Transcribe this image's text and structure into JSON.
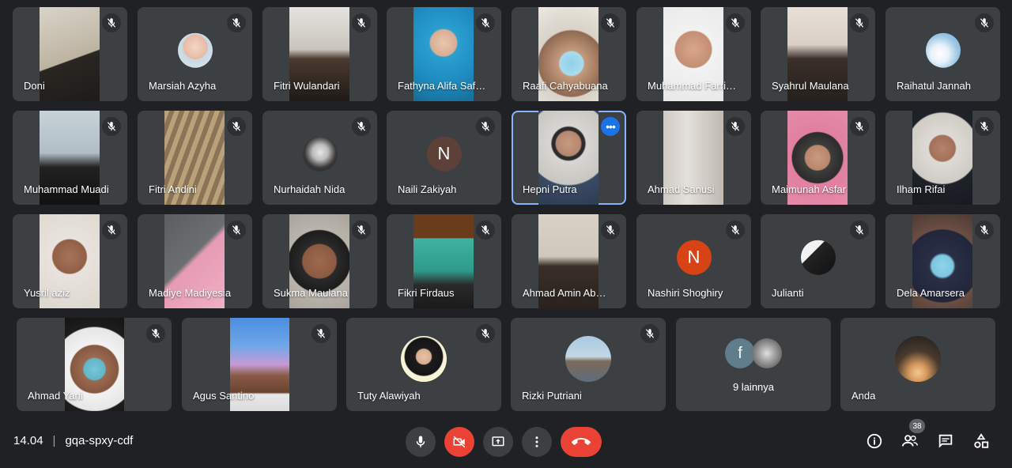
{
  "participants_row1": [
    {
      "name": "Doni"
    },
    {
      "name": "Marsiah Azyha"
    },
    {
      "name": "Fitri Wulandari"
    },
    {
      "name": "Fathyna Alifa Saf…"
    },
    {
      "name": "Raafi Cahyabuana"
    },
    {
      "name": "Muhammad Farri…"
    },
    {
      "name": "Syahrul Maulana"
    },
    {
      "name": "Raihatul Jannah"
    }
  ],
  "participants_row2": [
    {
      "name": "Muhammad Muadi"
    },
    {
      "name": "Fitri Andini"
    },
    {
      "name": "Nurhaidah Nida"
    },
    {
      "name": "Naili Zakiyah",
      "initial": "N"
    },
    {
      "name": "Hepni Putra"
    },
    {
      "name": "Ahmad Sanusi"
    },
    {
      "name": "Maimunah Asfar"
    },
    {
      "name": "Ilham Rifai"
    }
  ],
  "participants_row3": [
    {
      "name": "Yusril aziz"
    },
    {
      "name": "Madiye Madiyesia"
    },
    {
      "name": "Sukma Maulana"
    },
    {
      "name": "Fikri Firdaus"
    },
    {
      "name": "Ahmad Amin Ab…"
    },
    {
      "name": "Nashiri Shoghiry",
      "initial": "N"
    },
    {
      "name": "Julianti"
    },
    {
      "name": "Dela Amarsera"
    }
  ],
  "participants_row4": [
    {
      "name": "Ahmad Yani"
    },
    {
      "name": "Agus Santino"
    },
    {
      "name": "Tuty Alawiyah"
    },
    {
      "name": "Rizki Putriani"
    }
  ],
  "others_tile": {
    "initial": "f",
    "label": "9 lainnya"
  },
  "self_tile": {
    "name": "Anda"
  },
  "meeting": {
    "time": "14.04",
    "separator": "|",
    "code": "gqa-spxy-cdf"
  },
  "participant_count": "38",
  "colors": {
    "background": "#202124",
    "tile": "#3c4043",
    "accent_blue": "#1a73e8",
    "danger_red": "#ea4335"
  }
}
